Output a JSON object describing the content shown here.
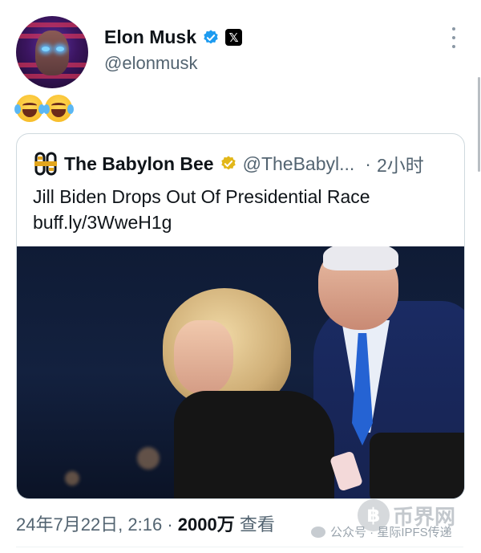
{
  "post": {
    "author_name": "Elon Musk",
    "author_handle": "@elonmusk",
    "x_logo": "𝕏",
    "verified_icon": "blue-verified-badge",
    "more_icon": "more-vertical-icon",
    "body_emojis": [
      "😂",
      "😂"
    ]
  },
  "quoted": {
    "author_name": "The Babylon Bee",
    "author_handle": "@TheBabyl...",
    "time": "2小时",
    "logo_icon": "babylon-bee-logo",
    "badge_icon": "gold-verified-badge",
    "headline": "Jill Biden Drops Out Of Presidential Race",
    "link": "buff.ly/3WweH1g"
  },
  "footer": {
    "timestamp": "24年7月22日, 2:16 ·",
    "views_count": "2000万",
    "views_label": "查看"
  },
  "watermarks": {
    "wechat": "公众号 · 星际IPFS传递",
    "site": "币界网"
  },
  "colors": {
    "verified_blue": "#1d9bf0",
    "gold_badge": "#e2b719",
    "muted_text": "#536471"
  }
}
